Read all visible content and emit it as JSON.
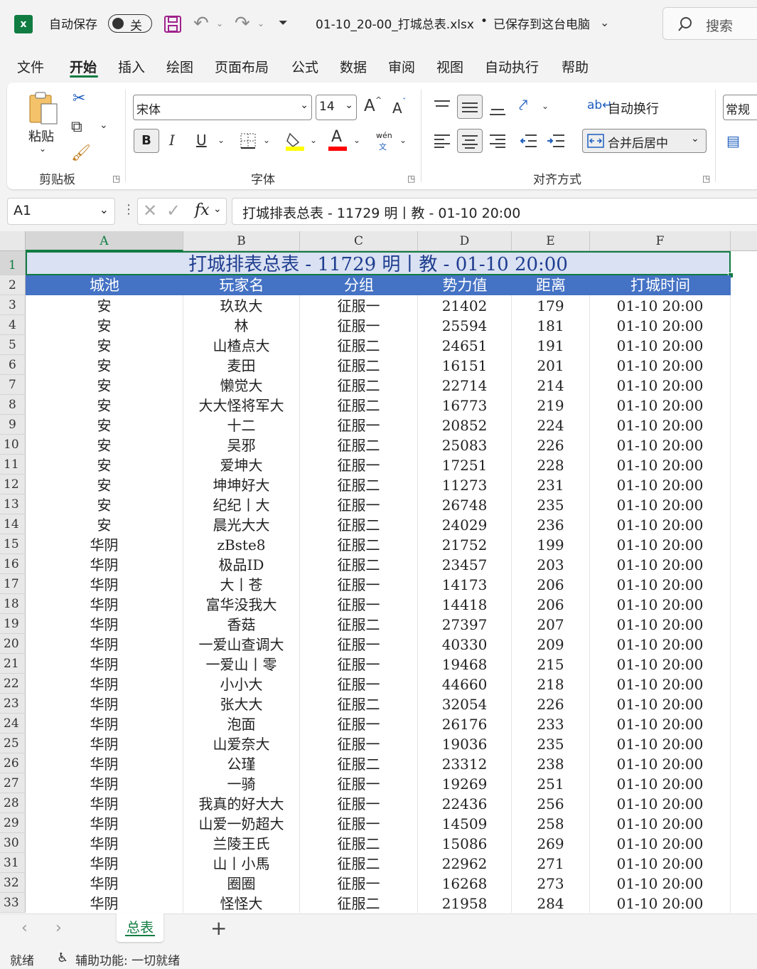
{
  "titlebar": {
    "autosave_label": "自动保存",
    "autosave_state": "关",
    "filename": "01-10_20-00_打城总表.xlsx",
    "bullet": "•",
    "save_status": "已保存到这台电脑",
    "search_placeholder": "搜索"
  },
  "menu": [
    "文件",
    "开始",
    "插入",
    "绘图",
    "页面布局",
    "公式",
    "数据",
    "审阅",
    "视图",
    "自动执行",
    "帮助"
  ],
  "ribbon": {
    "clipboard": {
      "paste_label": "粘贴",
      "group_label": "剪贴板"
    },
    "font": {
      "font_name": "宋体",
      "font_size": "14",
      "group_label": "字体",
      "bold": "B",
      "italic": "I",
      "underline": "U",
      "wen": "wén",
      "wen_sub": "文",
      "fill_color": "#ffff00",
      "font_color": "#ff0000",
      "grow_font": "A",
      "shrink_font": "A",
      "font_letter": "A"
    },
    "alignment": {
      "wrap_label": "自动换行",
      "merge_label": "合并后居中",
      "group_label": "对齐方式"
    },
    "number": {
      "format": "常规"
    }
  },
  "formula_bar": {
    "name_box": "A1",
    "fx": "fx",
    "formula": "打城排表总表 - 11729 明丨教 - 01-10 20:00"
  },
  "columns": [
    "A",
    "B",
    "C",
    "D",
    "E",
    "F"
  ],
  "sheet": {
    "title": "打城排表总表 - 11729 明丨教 - 01-10 20:00",
    "headers": [
      "城池",
      "玩家名",
      "分组",
      "势力值",
      "距离",
      "打城时间"
    ],
    "rows": [
      [
        "安",
        "玖玖大",
        "征服一",
        "21402",
        "179",
        "01-10 20:00"
      ],
      [
        "安",
        "林",
        "征服一",
        "25594",
        "181",
        "01-10 20:00"
      ],
      [
        "安",
        "山楂点大",
        "征服二",
        "24651",
        "191",
        "01-10 20:00"
      ],
      [
        "安",
        "麦田",
        "征服二",
        "16151",
        "201",
        "01-10 20:00"
      ],
      [
        "安",
        "懒觉大",
        "征服二",
        "22714",
        "214",
        "01-10 20:00"
      ],
      [
        "安",
        "大大怪将军大",
        "征服二",
        "16773",
        "219",
        "01-10 20:00"
      ],
      [
        "安",
        "十二",
        "征服一",
        "20852",
        "224",
        "01-10 20:00"
      ],
      [
        "安",
        "吴邪",
        "征服二",
        "25083",
        "226",
        "01-10 20:00"
      ],
      [
        "安",
        "爱坤大",
        "征服一",
        "17251",
        "228",
        "01-10 20:00"
      ],
      [
        "安",
        "坤坤好大",
        "征服二",
        "11273",
        "231",
        "01-10 20:00"
      ],
      [
        "安",
        "纪纪丨大",
        "征服一",
        "26748",
        "235",
        "01-10 20:00"
      ],
      [
        "安",
        "晨光大大",
        "征服二",
        "24029",
        "236",
        "01-10 20:00"
      ],
      [
        "华阴",
        "zBste8",
        "征服二",
        "21752",
        "199",
        "01-10 20:00"
      ],
      [
        "华阴",
        "极品ID",
        "征服二",
        "23457",
        "203",
        "01-10 20:00"
      ],
      [
        "华阴",
        "大丨苍",
        "征服一",
        "14173",
        "206",
        "01-10 20:00"
      ],
      [
        "华阴",
        "富华没我大",
        "征服一",
        "14418",
        "206",
        "01-10 20:00"
      ],
      [
        "华阴",
        "香菇",
        "征服二",
        "27397",
        "207",
        "01-10 20:00"
      ],
      [
        "华阴",
        "一爱山查调大",
        "征服一",
        "40330",
        "209",
        "01-10 20:00"
      ],
      [
        "华阴",
        "一爱山丨零",
        "征服一",
        "19468",
        "215",
        "01-10 20:00"
      ],
      [
        "华阴",
        "小小大",
        "征服一",
        "44660",
        "218",
        "01-10 20:00"
      ],
      [
        "华阴",
        "张大大",
        "征服二",
        "32054",
        "226",
        "01-10 20:00"
      ],
      [
        "华阴",
        "泡面",
        "征服一",
        "26176",
        "233",
        "01-10 20:00"
      ],
      [
        "华阴",
        "山爱奈大",
        "征服一",
        "19036",
        "235",
        "01-10 20:00"
      ],
      [
        "华阴",
        "公瑾",
        "征服二",
        "23312",
        "238",
        "01-10 20:00"
      ],
      [
        "华阴",
        "一骑",
        "征服一",
        "19269",
        "251",
        "01-10 20:00"
      ],
      [
        "华阴",
        "我真的好大大",
        "征服一",
        "22436",
        "256",
        "01-10 20:00"
      ],
      [
        "华阴",
        "山爱一奶超大",
        "征服一",
        "14509",
        "258",
        "01-10 20:00"
      ],
      [
        "华阴",
        "兰陵王氏",
        "征服二",
        "15086",
        "269",
        "01-10 20:00"
      ],
      [
        "华阴",
        "山丨小馬",
        "征服二",
        "22962",
        "271",
        "01-10 20:00"
      ],
      [
        "华阴",
        "圈圈",
        "征服一",
        "16268",
        "273",
        "01-10 20:00"
      ],
      [
        "华阴",
        "怪怪大",
        "征服二",
        "21958",
        "284",
        "01-10 20:00"
      ]
    ]
  },
  "sheet_tabs": [
    "总表"
  ],
  "status": {
    "ready": "就绪",
    "accessibility": "辅助功能: 一切就绪"
  },
  "colors": {
    "accent": "#107c41",
    "header_fill": "#4472c4",
    "title_fill": "#d9e1f2",
    "title_text": "#1f3d8f"
  }
}
